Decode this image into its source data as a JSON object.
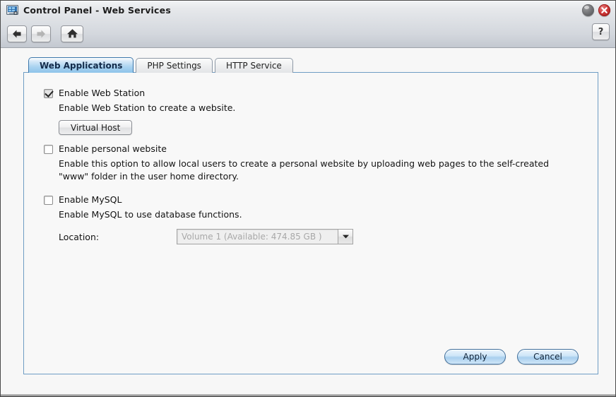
{
  "window": {
    "title": "Control Panel - Web Services",
    "icon": "control-panel-icon",
    "buttons": {
      "minimize_label": "",
      "close_label": "",
      "help_label": "?"
    }
  },
  "toolbar": {
    "back_icon": "arrow-left-icon",
    "forward_icon": "arrow-right-icon",
    "home_icon": "home-icon"
  },
  "tabs": [
    {
      "label": "Web Applications",
      "active": true
    },
    {
      "label": "PHP Settings",
      "active": false
    },
    {
      "label": "HTTP Service",
      "active": false
    }
  ],
  "options": {
    "web_station": {
      "label": "Enable Web Station",
      "checked": true,
      "description": "Enable Web Station to create a website.",
      "button_label": "Virtual Host"
    },
    "personal_website": {
      "label": "Enable personal website",
      "checked": false,
      "description": "Enable this option to allow local users to create a personal website by uploading web pages to the self-created \"www\" folder in the user home directory."
    },
    "mysql": {
      "label": "Enable MySQL",
      "checked": false,
      "description": "Enable MySQL to use database functions.",
      "location_label": "Location:",
      "location_value": "Volume 1 (Available: 474.85 GB )",
      "location_disabled": true,
      "dropdown_icon": "chevron-down-icon"
    }
  },
  "footer": {
    "apply_label": "Apply",
    "cancel_label": "Cancel"
  },
  "colors": {
    "accent_tab": "#8ec4ea",
    "panel_border": "#6f9dc4",
    "close_button": "#cf3b3b",
    "button_blue": "#a9cfee"
  }
}
